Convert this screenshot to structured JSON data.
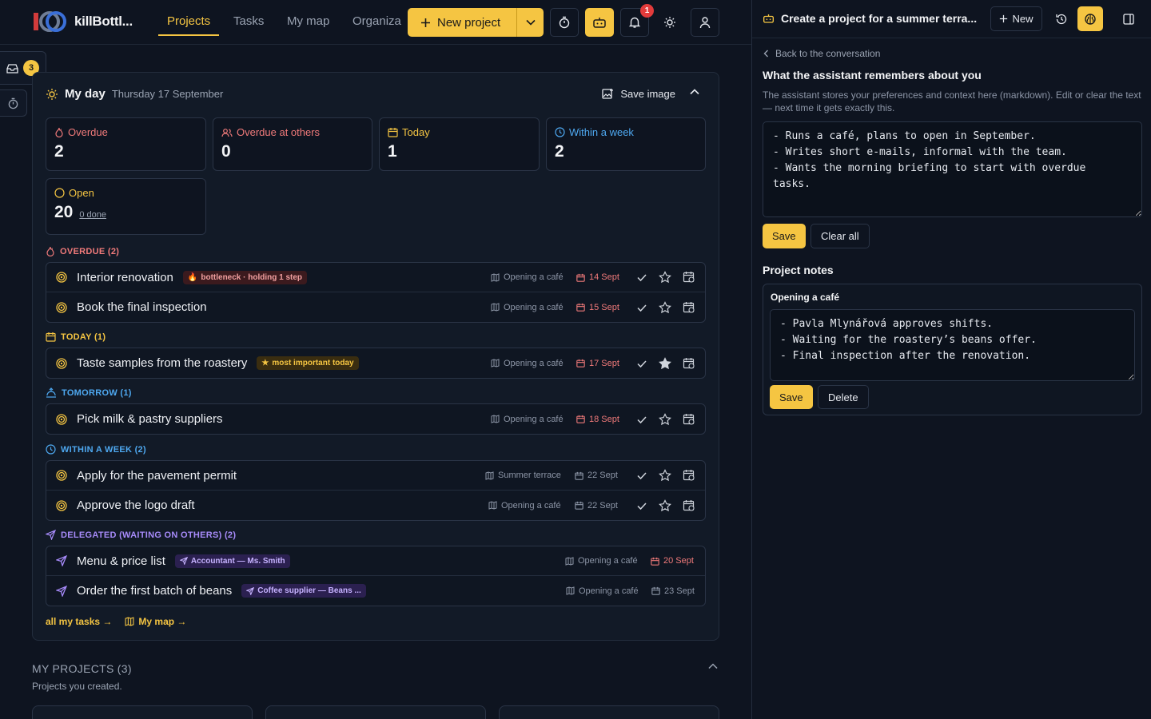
{
  "app": {
    "brand": "killBottl..."
  },
  "nav": {
    "projects": "Projects",
    "tasks": "Tasks",
    "my_map": "My map",
    "organize": "Organiza"
  },
  "toolbar": {
    "new_project": "New project",
    "notif_count": "1"
  },
  "sidebar": {
    "inbox_count": "3"
  },
  "myday": {
    "title": "My day",
    "date": "Thursday 17 September",
    "save_image": "Save image",
    "stats": {
      "overdue": {
        "label": "Overdue",
        "value": "2"
      },
      "overdue_others": {
        "label": "Overdue at others",
        "value": "0"
      },
      "today": {
        "label": "Today",
        "value": "1"
      },
      "week": {
        "label": "Within a week",
        "value": "2"
      },
      "open": {
        "label": "Open",
        "value": "20",
        "done": "0 done"
      }
    },
    "sections": {
      "overdue": {
        "label": "OVERDUE (2)",
        "tasks": [
          {
            "title": "Interior renovation",
            "tag": "bottleneck · holding 1 step",
            "project": "Opening a café",
            "due": "14 Sept"
          },
          {
            "title": "Book the final inspection",
            "project": "Opening a café",
            "due": "15 Sept"
          }
        ]
      },
      "today": {
        "label": "TODAY (1)",
        "tasks": [
          {
            "title": "Taste samples from the roastery",
            "tag": "most important today",
            "project": "Opening a café",
            "due": "17 Sept"
          }
        ]
      },
      "tomorrow": {
        "label": "TOMORROW (1)",
        "tasks": [
          {
            "title": "Pick milk & pastry suppliers",
            "project": "Opening a café",
            "due": "18 Sept"
          }
        ]
      },
      "week": {
        "label": "WITHIN A WEEK (2)",
        "tasks": [
          {
            "title": "Apply for the pavement permit",
            "project": "Summer terrace",
            "due": "22 Sept"
          },
          {
            "title": "Approve the logo draft",
            "project": "Opening a café",
            "due": "22 Sept"
          }
        ]
      },
      "delegated": {
        "label": "DELEGATED (WAITING ON OTHERS) (2)",
        "tasks": [
          {
            "title": "Menu & price list",
            "tag": "Accountant — Ms. Smith",
            "project": "Opening a café",
            "due": "20 Sept"
          },
          {
            "title": "Order the first batch of beans",
            "tag": "Coffee supplier — Beans ...",
            "project": "Opening a café",
            "due": "23 Sept"
          }
        ]
      }
    },
    "links": {
      "all_tasks": "all my tasks →",
      "my_map": "My map →"
    }
  },
  "projects": {
    "title": "MY PROJECTS (3)",
    "subtitle": "Projects you created."
  },
  "panel": {
    "title": "Create a project for a summer terra...",
    "new_label": "New",
    "back": "Back to the conversation",
    "memory_title": "What the assistant remembers about you",
    "memory_desc": "The assistant stores your preferences and context here (markdown). Edit or clear the text — next time it gets exactly this.",
    "memory_text": "- Runs a café, plans to open in September.\n- Writes short e-mails, informal with the team.\n- Wants the morning briefing to start with overdue\ntasks.",
    "save": "Save",
    "clear_all": "Clear all",
    "notes_title": "Project notes",
    "note_project": "Opening a café",
    "note_text": "- Pavla Mlynářová approves shifts.\n- Waiting for the roastery’s beans offer.\n- Final inspection after the renovation.",
    "note_save": "Save",
    "note_delete": "Delete"
  },
  "colors": {
    "accent": "#f5c542",
    "overdue": "#f07a7a",
    "others": "#f07a7a",
    "today": "#f5c542",
    "tomorrow": "#4ea8f0",
    "week": "#4ea8f0",
    "delegated": "#a78bfa"
  }
}
